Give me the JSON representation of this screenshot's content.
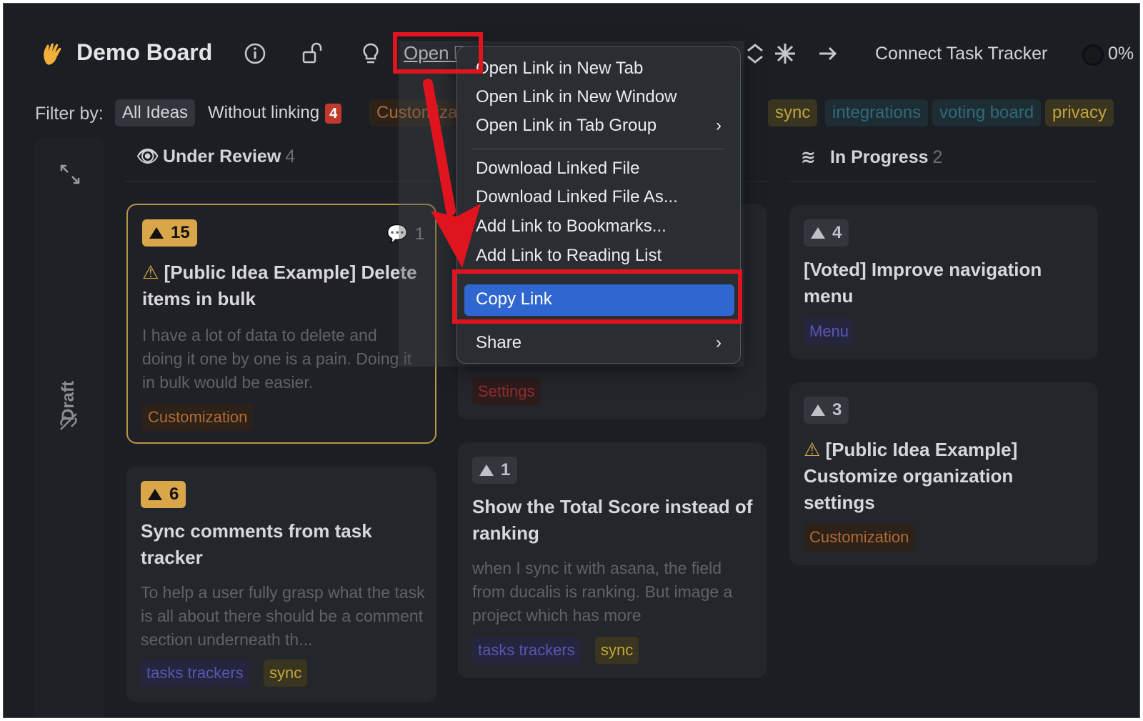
{
  "header": {
    "title": "Demo Board",
    "open_label": "Open",
    "connect_label": "Connect Task Tracker",
    "progress": "0%"
  },
  "filter": {
    "label": "Filter by:",
    "chips": {
      "all": "All Ideas",
      "without": "Without linking",
      "without_count": "4",
      "custom": "Customizati",
      "sync": "sync",
      "integrations": "integrations",
      "voting": "voting board",
      "privacy": "privacy"
    }
  },
  "sidebar": {
    "draft_label": "Draft"
  },
  "columns": {
    "review": {
      "title": "Under Review",
      "count": "4"
    },
    "progress": {
      "title": "In Progress",
      "count": "2"
    }
  },
  "cards": {
    "c1": {
      "votes": "15",
      "comments": "1",
      "title": "[Public Idea Example] Delete items in bulk",
      "desc": "I have a lot of data to delete and doing it one by one is a pain. Doing it in bulk would be easier.",
      "tag": "Customization"
    },
    "c2": {
      "votes": "6",
      "title": "Sync comments from task tracker",
      "desc": "To help a user fully grasp what the task is all about there should be a comment section underneath th...",
      "tags": [
        "tasks trackers",
        "sync"
      ]
    },
    "c3": {
      "tag": "Settings"
    },
    "c4": {
      "votes": "1",
      "title": "Show the Total Score instead of ranking",
      "desc": "when I sync it with asana, the field from ducalis is ranking. But image a project which has more",
      "tags": [
        "tasks trackers",
        "sync"
      ]
    },
    "c5": {
      "votes": "4",
      "title": "[Voted] Improve navigation menu",
      "tag": "Menu"
    },
    "c6": {
      "votes": "3",
      "title": "[Public Idea Example] Customize organization settings",
      "tag": "Customization"
    }
  },
  "context_menu": {
    "items": [
      "Open Link in New Tab",
      "Open Link in New Window",
      "Open Link in Tab Group",
      "Download Linked File",
      "Download Linked File As...",
      "Add Link to Bookmarks...",
      "Add Link to Reading List",
      "Copy Link",
      "Share"
    ]
  },
  "colors": {
    "background": "#1b1e23",
    "highlight": "#2f66d0",
    "annotation": "#e0141e",
    "vote_hot": "#d9a74a"
  }
}
